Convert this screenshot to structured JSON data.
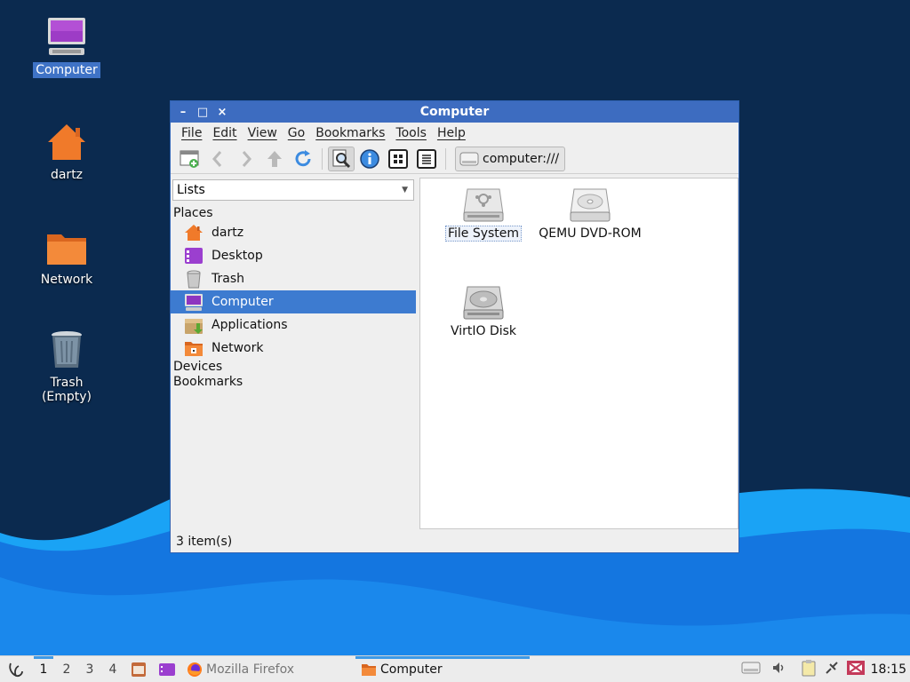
{
  "desktop": {
    "icons": [
      {
        "label": "Computer",
        "icon": "computer-icon",
        "selected": true
      },
      {
        "label": "dartz",
        "icon": "home-folder-icon"
      },
      {
        "label": "Network",
        "icon": "network-folder-icon"
      },
      {
        "label": "Trash (Empty)",
        "icon": "trash-icon"
      }
    ]
  },
  "window": {
    "title": "Computer",
    "controls": {
      "minimize": "–",
      "maximize": "□",
      "close": "×"
    },
    "menu": [
      "File",
      "Edit",
      "View",
      "Go",
      "Bookmarks",
      "Tools",
      "Help"
    ],
    "toolbar": {
      "buttons": [
        "new-tab-icon",
        "back-icon",
        "forward-icon",
        "up-icon",
        "reload-icon",
        "search-files-icon",
        "info-icon",
        "icon-view-icon",
        "list-view-icon"
      ],
      "location": "computer:///"
    },
    "sidepane": {
      "mode": "Lists",
      "sections": {
        "places": "Places",
        "devices": "Devices",
        "bookmarks": "Bookmarks"
      },
      "places": [
        {
          "label": "dartz",
          "icon": "home-icon"
        },
        {
          "label": "Desktop",
          "icon": "desktop-icon"
        },
        {
          "label": "Trash",
          "icon": "trash-icon"
        },
        {
          "label": "Computer",
          "icon": "computer-icon",
          "selected": true
        },
        {
          "label": "Applications",
          "icon": "applications-icon"
        },
        {
          "label": "Network",
          "icon": "network-icon"
        }
      ]
    },
    "files": [
      {
        "label": "File System",
        "icon": "hard-drive-icon",
        "focused": true
      },
      {
        "label": "QEMU DVD-ROM",
        "icon": "optical-drive-icon"
      },
      {
        "label": "VirtIO Disk",
        "icon": "hard-disk-icon"
      }
    ],
    "status": "3 item(s)"
  },
  "taskbar": {
    "workspaces": [
      "1",
      "2",
      "3",
      "4"
    ],
    "active_workspace": "1",
    "tasks": [
      {
        "label": "Mozilla Firefox",
        "icon": "firefox-icon"
      },
      {
        "label": "Computer",
        "icon": "folder-icon",
        "active": true
      }
    ],
    "clock": "18:15"
  },
  "colors": {
    "titlebar": "#3d6cc0",
    "selection": "#3d7bd0",
    "desktop_dark": "#0b2a4f",
    "desktop_wave": "#1c8ff0"
  }
}
